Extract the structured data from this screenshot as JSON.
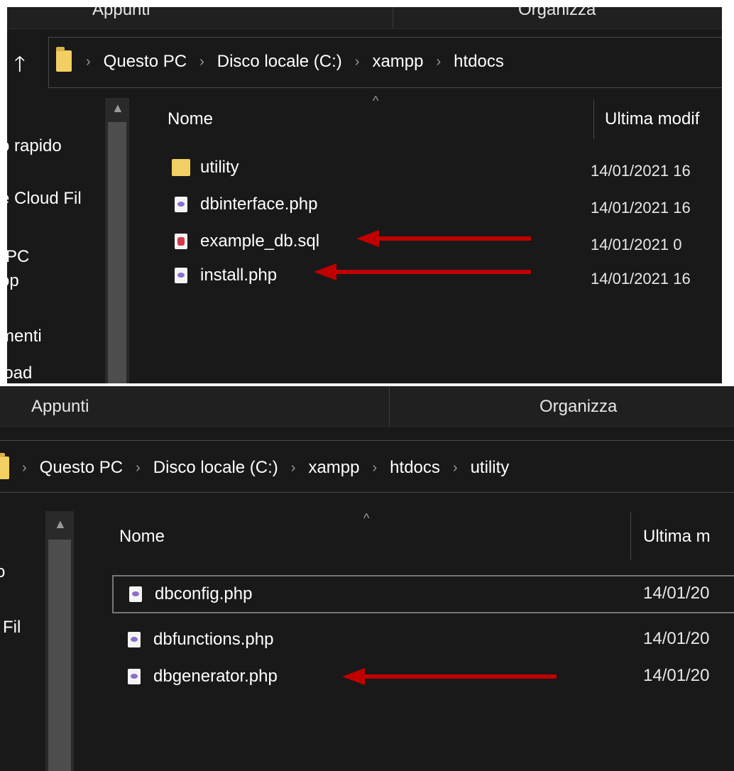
{
  "top": {
    "ribbon": {
      "left_label": "Appunti",
      "right_label": "Organizza"
    },
    "breadcrumb": [
      "Questo PC",
      "Disco locale (C:)",
      "xampp",
      "htdocs"
    ],
    "nav_items": [
      "o rapido",
      "e Cloud Fil",
      "PC",
      "op",
      "menti",
      "load"
    ],
    "columns": {
      "name": "Nome",
      "modified": "Ultima modif"
    },
    "files": [
      {
        "icon": "folder-icon",
        "name": "utility",
        "date": "14/01/2021 16"
      },
      {
        "icon": "php-file-icon",
        "name": "dbinterface.php",
        "date": "14/01/2021 16"
      },
      {
        "icon": "sql-file-icon",
        "name": "example_db.sql",
        "date": "14/01/2021 0"
      },
      {
        "icon": "php-file-icon",
        "name": "install.php",
        "date": "14/01/2021 16"
      }
    ]
  },
  "bottom": {
    "ribbon": {
      "left_label": "Appunti",
      "right_label": "Organizza"
    },
    "breadcrumb": [
      "Questo PC",
      "Disco locale (C:)",
      "xampp",
      "htdocs",
      "utility"
    ],
    "nav_items": [
      "o",
      "l Fil"
    ],
    "columns": {
      "name": "Nome",
      "modified": "Ultima m"
    },
    "files": [
      {
        "icon": "php-file-icon",
        "name": "dbconfig.php",
        "date": "14/01/20",
        "selected": true
      },
      {
        "icon": "php-file-icon",
        "name": "dbfunctions.php",
        "date": "14/01/20"
      },
      {
        "icon": "php-file-icon",
        "name": "dbgenerator.php",
        "date": "14/01/20"
      }
    ]
  },
  "colors": {
    "background": "#191919",
    "folder": "#f2cf63",
    "annotation_arrow": "#c00000"
  }
}
